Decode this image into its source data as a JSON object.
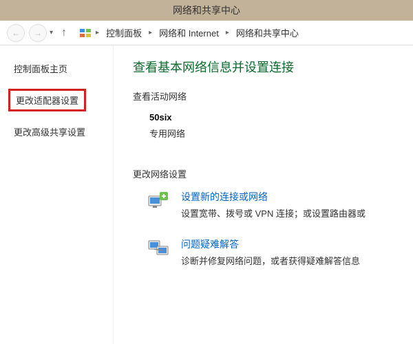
{
  "titlebar": {
    "title": "网络和共享中心"
  },
  "breadcrumb": {
    "items": [
      "控制面板",
      "网络和 Internet",
      "网络和共享中心"
    ]
  },
  "sidebar": {
    "home": "控制面板主页",
    "adapter": "更改适配器设置",
    "advanced": "更改高级共享设置"
  },
  "main": {
    "title": "查看基本网络信息并设置连接",
    "active_label": "查看活动网络",
    "network_name": "50six",
    "network_type": "专用网络",
    "change_label": "更改网络设置",
    "items": [
      {
        "link": "设置新的连接或网络",
        "desc": "设置宽带、拨号或 VPN 连接；或设置路由器或"
      },
      {
        "link": "问题疑难解答",
        "desc": "诊断并修复网络问题，或者获得疑难解答信息"
      }
    ]
  }
}
